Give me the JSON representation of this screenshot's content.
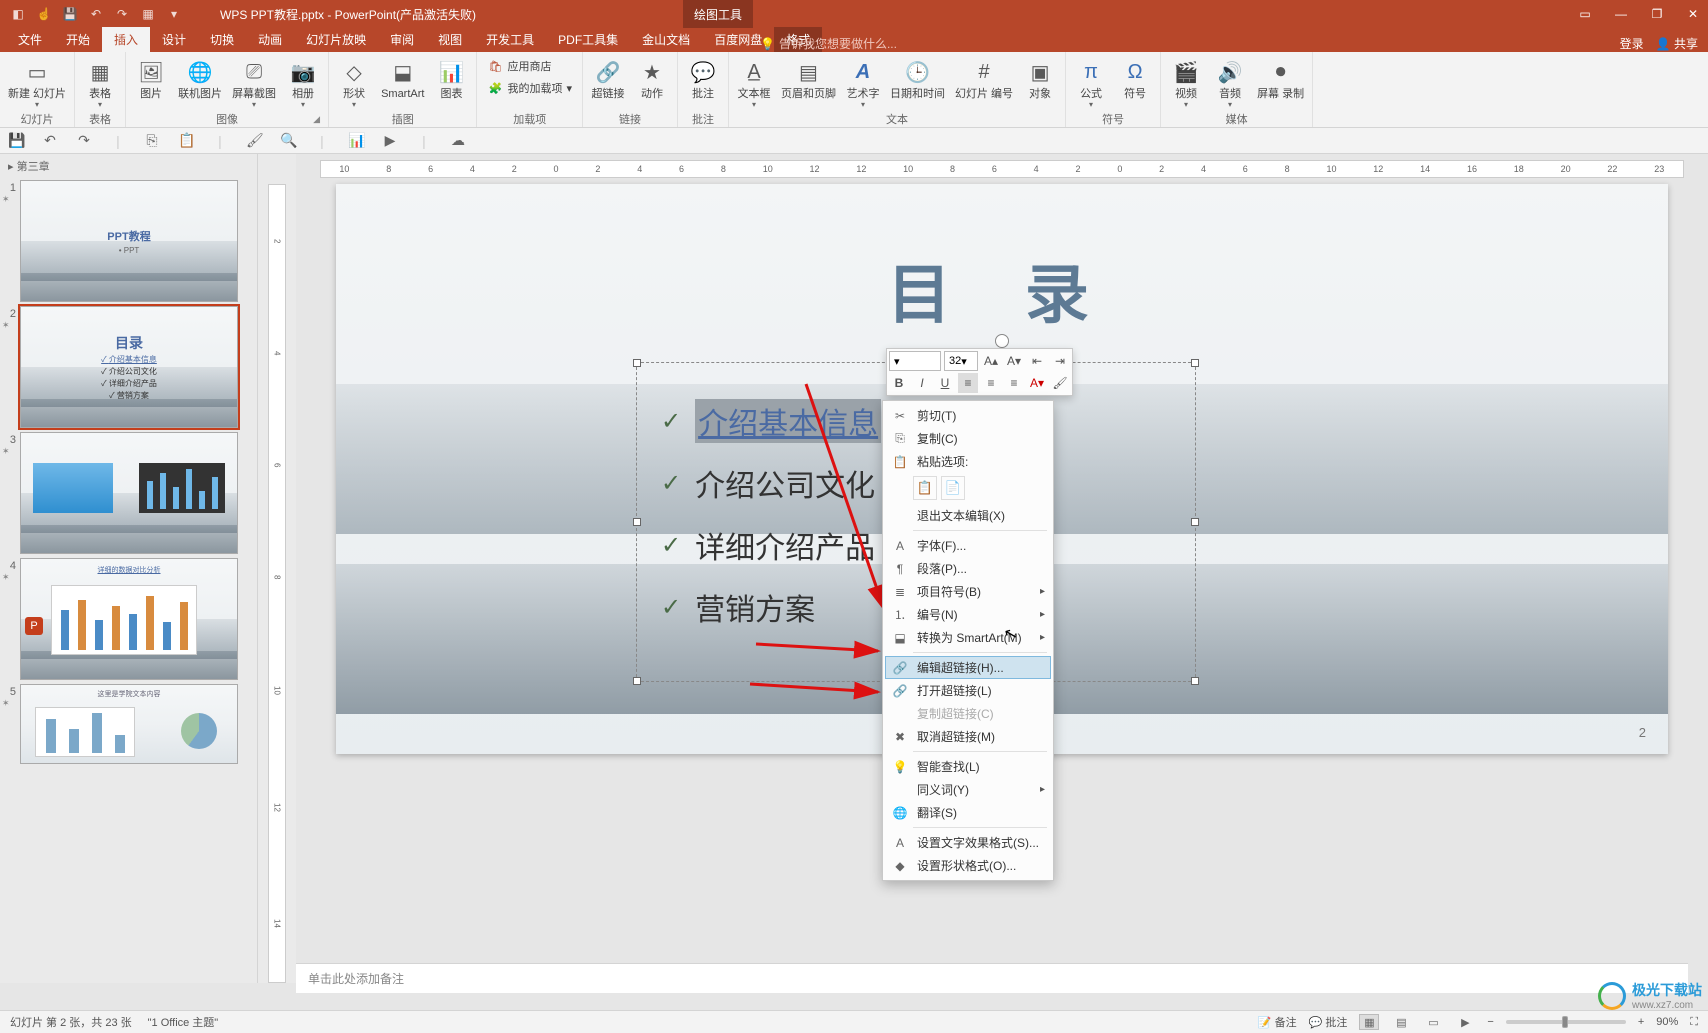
{
  "titlebar": {
    "filename": "WPS PPT教程.pptx - PowerPoint(产品激活失败)",
    "drawtools": "绘图工具"
  },
  "tabs": {
    "file": "文件",
    "home": "开始",
    "insert": "插入",
    "design": "设计",
    "trans": "切换",
    "anim": "动画",
    "slideshow": "幻灯片放映",
    "review": "审阅",
    "view": "视图",
    "dev": "开发工具",
    "pdf": "PDF工具集",
    "jinshan": "金山文档",
    "baidu": "百度网盘",
    "format": "格式",
    "tell": "告诉我您想要做什么...",
    "login": "登录",
    "share": "共享"
  },
  "ribbon": {
    "newslide": "新建\n幻灯片",
    "table": "表格",
    "g_slide": "幻灯片",
    "g_table": "表格",
    "picture": "图片",
    "online": "联机图片",
    "screenshot": "屏幕截图",
    "album": "相册",
    "g_image": "图像",
    "shapes": "形状",
    "smartart": "SmartArt",
    "chart": "图表",
    "g_illust": "插图",
    "store": "应用商店",
    "addins": "我的加载项",
    "g_addins": "加载项",
    "link": "超链接",
    "action": "动作",
    "g_link": "链接",
    "comment": "批注",
    "g_comment": "批注",
    "textbox": "文本框",
    "headerfooter": "页眉和页脚",
    "wordart": "艺术字",
    "datetime": "日期和时间",
    "slidenum": "幻灯片\n编号",
    "object": "对象",
    "g_text": "文本",
    "equation": "公式",
    "symbol": "符号",
    "g_symbol": "符号",
    "video": "视频",
    "audio": "音频",
    "screenrec": "屏幕\n录制",
    "g_media": "媒体"
  },
  "section": {
    "ch3": "第三章"
  },
  "thumbs": {
    "s1": {
      "title": "PPT教程",
      "sub": "• PPT"
    },
    "s2": {
      "title": "目录",
      "b1": "介绍基本信息",
      "b2": "介绍公司文化",
      "b3": "详细介绍产品",
      "b4": "营销方案"
    },
    "s3_placeholder": "",
    "s4_placeholder": "详细的数据对比分析",
    "s5_placeholder": "这里是学院文本内容"
  },
  "ruler_h": [
    "10",
    "8",
    "6",
    "4",
    "2",
    "0",
    "2",
    "4",
    "6",
    "8",
    "10",
    "12",
    "12",
    "10",
    "8",
    "6",
    "4",
    "2",
    "0",
    "2",
    "4",
    "6",
    "8",
    "10",
    "12",
    "14",
    "16",
    "18",
    "20",
    "22",
    "23"
  ],
  "ruler_v": [
    "2",
    "4",
    "6",
    "8",
    "10",
    "12",
    "14"
  ],
  "slide": {
    "title": "目 录",
    "b1": "介绍基本信息",
    "b2": "介绍公司文化",
    "b3": "详细介绍产品",
    "b4": "营销方案",
    "pgno": "2"
  },
  "minitb": {
    "fontsize": "32"
  },
  "ctx": {
    "cut": "剪切(T)",
    "copy": "复制(C)",
    "pasteopt": "粘贴选项:",
    "exitedit": "退出文本编辑(X)",
    "font": "字体(F)...",
    "para": "段落(P)...",
    "bullets": "项目符号(B)",
    "numbering": "编号(N)",
    "tosmart": "转换为 SmartArt(M)",
    "edithyper": "编辑超链接(H)...",
    "openhyper": "打开超链接(L)",
    "copyhyper": "复制超链接(C)",
    "removehyper": "取消超链接(M)",
    "smartlookup": "智能查找(L)",
    "synonym": "同义词(Y)",
    "translate": "翻译(S)",
    "texteffect": "设置文字效果格式(S)...",
    "shapeformat": "设置形状格式(O)..."
  },
  "notes": {
    "placeholder": "单击此处添加备注"
  },
  "status": {
    "slideinfo": "幻灯片 第 2 张，共 23 张",
    "theme": "\"1 Office 主题\"",
    "notesbtn": "备注",
    "commentsbtn": "批注",
    "zoom": "90%"
  },
  "watermark": {
    "name": "极光下载站",
    "url": "www.xz7.com"
  }
}
